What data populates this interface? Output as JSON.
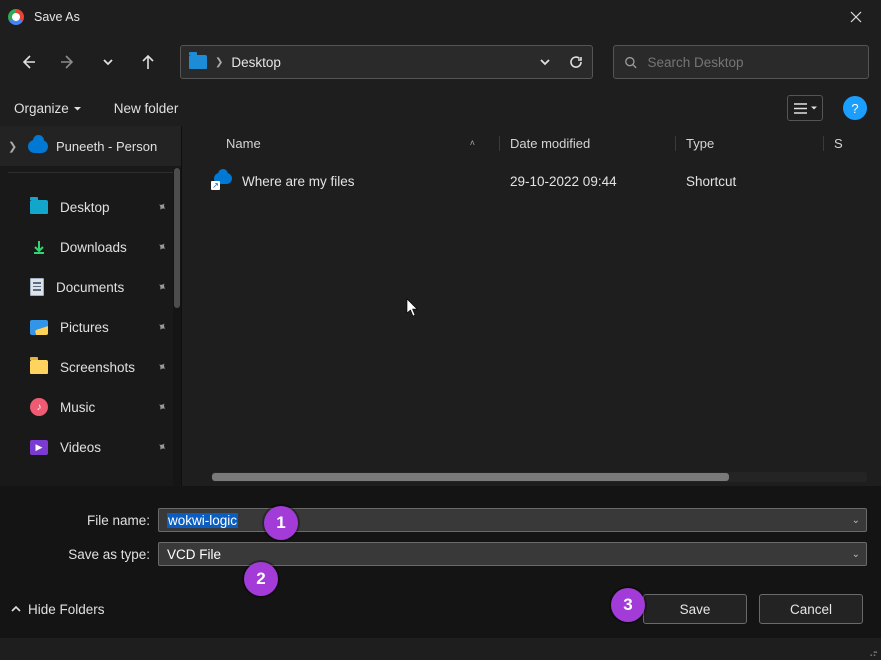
{
  "title": "Save As",
  "path": {
    "location": "Desktop"
  },
  "search": {
    "placeholder": "Search Desktop"
  },
  "toolbar": {
    "organize": "Organize",
    "new_folder": "New folder",
    "help": "?"
  },
  "sidebar": {
    "top": "Puneeth - Person",
    "items": [
      {
        "label": "Desktop",
        "icon": "desktop"
      },
      {
        "label": "Downloads",
        "icon": "download"
      },
      {
        "label": "Documents",
        "icon": "doc"
      },
      {
        "label": "Pictures",
        "icon": "pic"
      },
      {
        "label": "Screenshots",
        "icon": "folder-yellow"
      },
      {
        "label": "Music",
        "icon": "music"
      },
      {
        "label": "Videos",
        "icon": "video"
      }
    ]
  },
  "cols": {
    "name": "Name",
    "date": "Date modified",
    "type": "Type",
    "size": "S"
  },
  "files": [
    {
      "name": "Where are my files",
      "date": "29-10-2022 09:44",
      "type": "Shortcut"
    }
  ],
  "form": {
    "filename_label": "File name:",
    "filename_value": "wokwi-logic",
    "type_label": "Save as type:",
    "type_value": "VCD File"
  },
  "footer": {
    "hide_folders": "Hide Folders",
    "save": "Save",
    "cancel": "Cancel"
  },
  "annotations": {
    "b1": "1",
    "b2": "2",
    "b3": "3"
  }
}
